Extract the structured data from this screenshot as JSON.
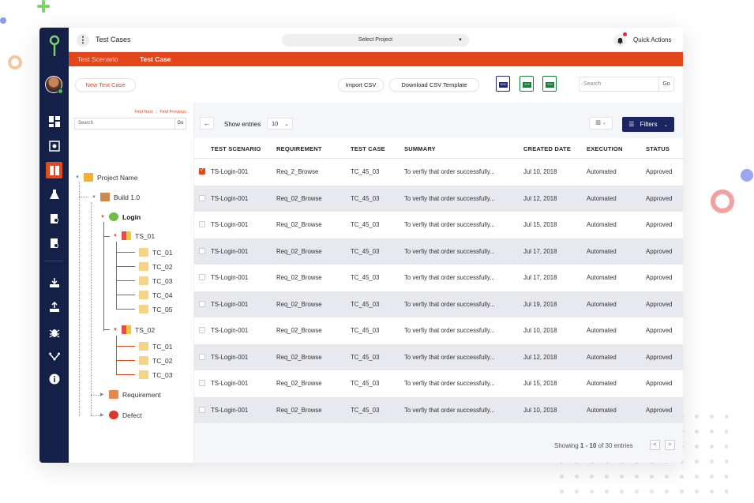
{
  "topbar": {
    "title": "Test Cases",
    "project_select": "Select Project",
    "quick_actions": "Quick Actions"
  },
  "tabs": [
    {
      "label": "Test Scenario",
      "active": false
    },
    {
      "label": "Test Case",
      "active": true
    }
  ],
  "actions": {
    "new_test_case": "New Test Case",
    "import_csv": "Import CSV",
    "download_template": "Download CSV Template",
    "search_placeholder": "Search",
    "search_go": "Go",
    "file_icons": [
      "DOC",
      "XLS",
      "CSV"
    ]
  },
  "tree": {
    "find_next": "Find Next",
    "find_previous": "Find Previous",
    "separator": "|",
    "search_placeholder": "Search",
    "search_go": "Go",
    "nodes": {
      "project": "Project Name",
      "build": "Build 1.0",
      "login": "Login",
      "ts01": "TS_01",
      "ts01_cases": [
        "TC_01",
        "TC_02",
        "TC_03",
        "TC_04",
        "TC_05"
      ],
      "ts02": "TS_02",
      "ts02_cases": [
        "TC_01",
        "TC_02",
        "TC_03"
      ],
      "requirement": "Requirement",
      "defect": "Defect"
    }
  },
  "table": {
    "show_entries": "Show entries",
    "entries_value": "10",
    "filters": "Filters",
    "headers": [
      "TEST SCENARIO",
      "REQUIREMENT",
      "TEST CASE",
      "SUMMARY",
      "CREATED DATE",
      "EXECUTION",
      "STATUS"
    ],
    "rows": [
      {
        "checked": true,
        "scenario": "TS-Login-001",
        "requirement": "Req_2_Browse",
        "test_case": "TC_45_03",
        "summary": "To verfiy that order successfully...",
        "created": "Jul 10, 2018",
        "execution": "Automated",
        "status": "Approved"
      },
      {
        "checked": false,
        "scenario": "TS-Login-001",
        "requirement": "Req_02_Browse",
        "test_case": "TC_45_03",
        "summary": "To verfiy that order successfully...",
        "created": "Jul 12, 2018",
        "execution": "Automated",
        "status": "Approved"
      },
      {
        "checked": false,
        "scenario": "TS-Login-001",
        "requirement": "Req_02_Browse",
        "test_case": "TC_45_03",
        "summary": "To verfiy that order successfully...",
        "created": "Jul 15, 2018",
        "execution": "Automated",
        "status": "Approved"
      },
      {
        "checked": false,
        "scenario": "TS-Login-001",
        "requirement": "Req_02_Browse",
        "test_case": "TC_45_03",
        "summary": "To verfiy that order successfully...",
        "created": "Jul 17, 2018",
        "execution": "Automated",
        "status": "Approved"
      },
      {
        "checked": false,
        "scenario": "TS-Login-001",
        "requirement": "Req_02_Browse",
        "test_case": "TC_45_03",
        "summary": "To verfiy that order successfully...",
        "created": "Jul 17, 2018",
        "execution": "Automated",
        "status": "Approved"
      },
      {
        "checked": false,
        "scenario": "TS-Login-001",
        "requirement": "Req_02_Browse",
        "test_case": "TC_45_03",
        "summary": "To verfiy that order successfully...",
        "created": "Jul 19, 2018",
        "execution": "Automated",
        "status": "Approved"
      },
      {
        "checked": false,
        "scenario": "TS-Login-001",
        "requirement": "Req_02_Browse",
        "test_case": "TC_45_03",
        "summary": "To verfiy that order successfully...",
        "created": "Jul 10, 2018",
        "execution": "Automated",
        "status": "Approved"
      },
      {
        "checked": false,
        "scenario": "TS-Login-001",
        "requirement": "Req_02_Browse",
        "test_case": "TC_45_03",
        "summary": "To verfiy that order successfully...",
        "created": "Jul 12, 2018",
        "execution": "Automated",
        "status": "Approved"
      },
      {
        "checked": false,
        "scenario": "TS-Login-001",
        "requirement": "Req_02_Browse",
        "test_case": "TC_45_03",
        "summary": "To verfiy that order successfully...",
        "created": "Jul 15, 2018",
        "execution": "Automated",
        "status": "Approved"
      },
      {
        "checked": false,
        "scenario": "TS-Login-001",
        "requirement": "Req_02_Browse",
        "test_case": "TC_45_03",
        "summary": "To verfiy that order successfully...",
        "created": "Jul 10, 2018",
        "execution": "Automated",
        "status": "Approved"
      }
    ],
    "pager": {
      "showing": "Showing",
      "range": "1 - 10",
      "of": "of 30 entries",
      "prev": "<",
      "next": ">"
    }
  },
  "colors": {
    "accent": "#e3461b",
    "nav_bg": "#152048",
    "filters_bg": "#1b2660"
  }
}
